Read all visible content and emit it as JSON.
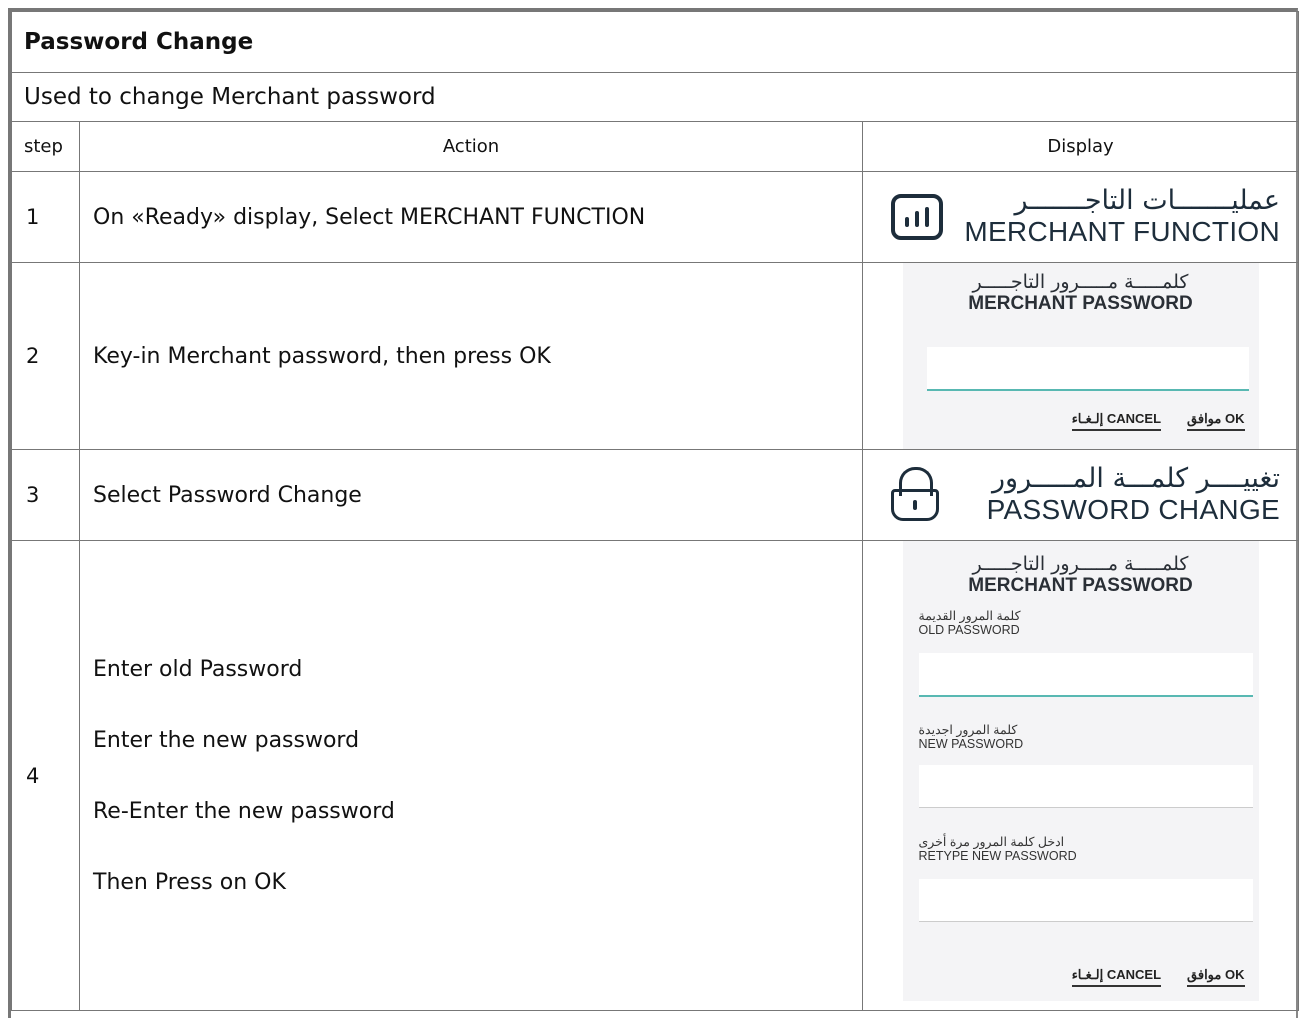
{
  "header": {
    "title": "Password Change",
    "description": "Used to change Merchant password"
  },
  "columns": {
    "step": "step",
    "action": "Action",
    "display": "Display"
  },
  "steps": [
    {
      "step": "1",
      "action": [
        "On «Ready» display, Select MERCHANT FUNCTION"
      ]
    },
    {
      "step": "2",
      "action": [
        "Key-in Merchant password, then press OK"
      ]
    },
    {
      "step": "3",
      "action": [
        "Select Password Change"
      ]
    },
    {
      "step": "4",
      "action": [
        "Enter old Password",
        "Enter the new password",
        "Re-Enter the new password",
        "Then Press on OK"
      ]
    }
  ],
  "displays": {
    "merchant_function": {
      "ar": "عمليـــــــات التاجـــــــر",
      "en": "MERCHANT FUNCTION",
      "icon": "bar-chart-icon"
    },
    "merchant_password": {
      "title_ar": "كلمـــــة مـــــرور التاجـــــر",
      "title_en": "MERCHANT PASSWORD",
      "ok": "موافق OK",
      "cancel": "إلـغـاء CANCEL"
    },
    "password_change": {
      "ar": "تغييــــر كلمـــة المـــــرور",
      "en": "PASSWORD CHANGE",
      "icon": "lock-icon"
    },
    "change_form": {
      "title_ar": "كلمـــــة مـــــرور التاجـــــر",
      "title_en": "MERCHANT PASSWORD",
      "old_ar": "كلمة المرور القديمة",
      "old_en": "OLD PASSWORD",
      "new_ar": "كلمة المرور اجديدة",
      "new_en": "NEW PASSWORD",
      "retype_ar": "ادخل كلمة المرور مرة أخرى",
      "retype_en": "RETYPE NEW PASSWORD",
      "ok": "موافق OK",
      "cancel": "إلـغـاء CANCEL"
    }
  }
}
